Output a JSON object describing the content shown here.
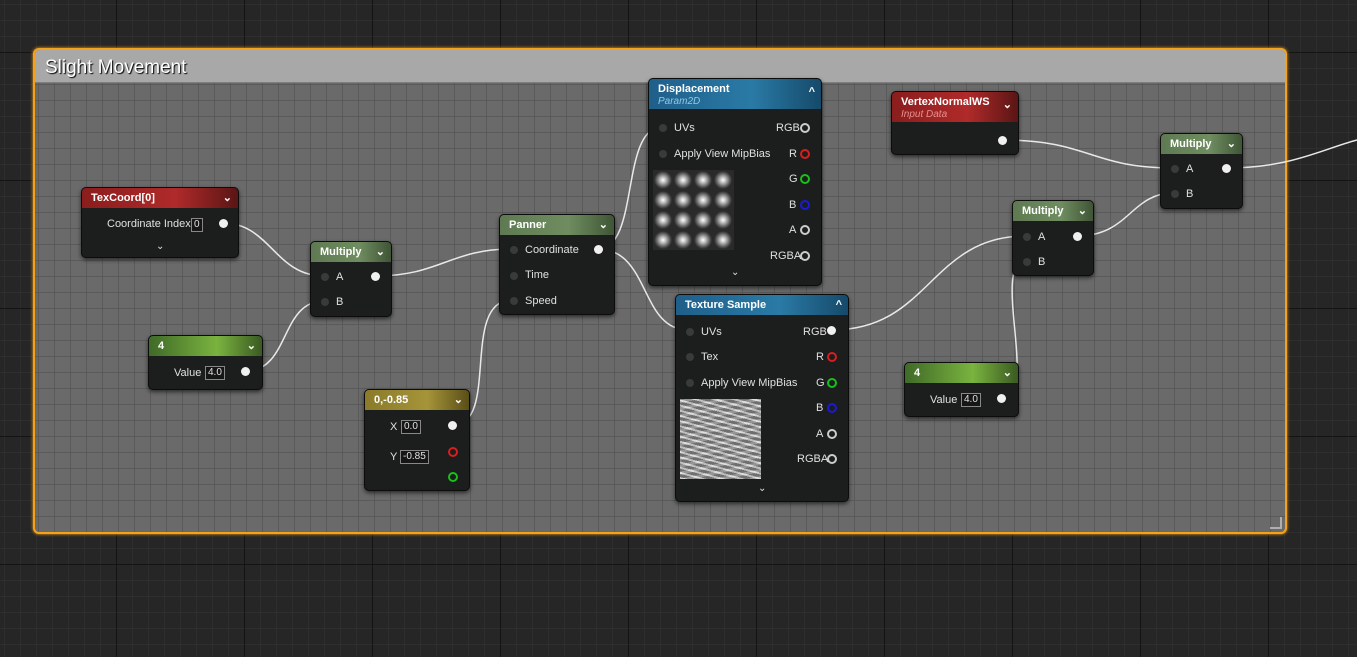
{
  "comment": {
    "title": "Slight Movement"
  },
  "nodes": {
    "texcoord": {
      "title": "TexCoord[0]",
      "row_label": "Coordinate Index",
      "value": "0"
    },
    "multiply1": {
      "title": "Multiply",
      "pin_a": "A",
      "pin_b": "B"
    },
    "const1": {
      "title": "4",
      "value_label": "Value",
      "value": "4.0"
    },
    "panner": {
      "title": "Panner",
      "pins": [
        "Coordinate",
        "Time",
        "Speed"
      ]
    },
    "const2vec": {
      "title": "0,-0.85",
      "x_label": "X",
      "x_value": "0.0",
      "y_label": "Y",
      "y_value": "-0.85"
    },
    "displacement": {
      "title": "Displacement",
      "subtitle": "Param2D",
      "in_uvs": "UVs",
      "in_mip": "Apply View MipBias",
      "out": [
        "RGB",
        "R",
        "G",
        "B",
        "A",
        "RGBA"
      ]
    },
    "texture_sample": {
      "title": "Texture Sample",
      "in_uvs": "UVs",
      "in_tex": "Tex",
      "in_mip": "Apply View MipBias",
      "out": [
        "RGB",
        "R",
        "G",
        "B",
        "A",
        "RGBA"
      ]
    },
    "vertexnormal": {
      "title": "VertexNormalWS",
      "subtitle": "Input Data"
    },
    "multiply2": {
      "title": "Multiply",
      "pin_a": "A",
      "pin_b": "B"
    },
    "const2": {
      "title": "4",
      "value_label": "Value",
      "value": "4.0"
    },
    "multiply3": {
      "title": "Multiply",
      "pin_a": "A",
      "pin_b": "B"
    }
  },
  "icons": {
    "collapse": "chevron-down-icon",
    "expand": "chevron-up-icon"
  },
  "colors": {
    "comment_border": "#f5a21b",
    "pin_r": "#d81e1e",
    "pin_g": "#19c019",
    "pin_b": "#1a1ad8"
  }
}
